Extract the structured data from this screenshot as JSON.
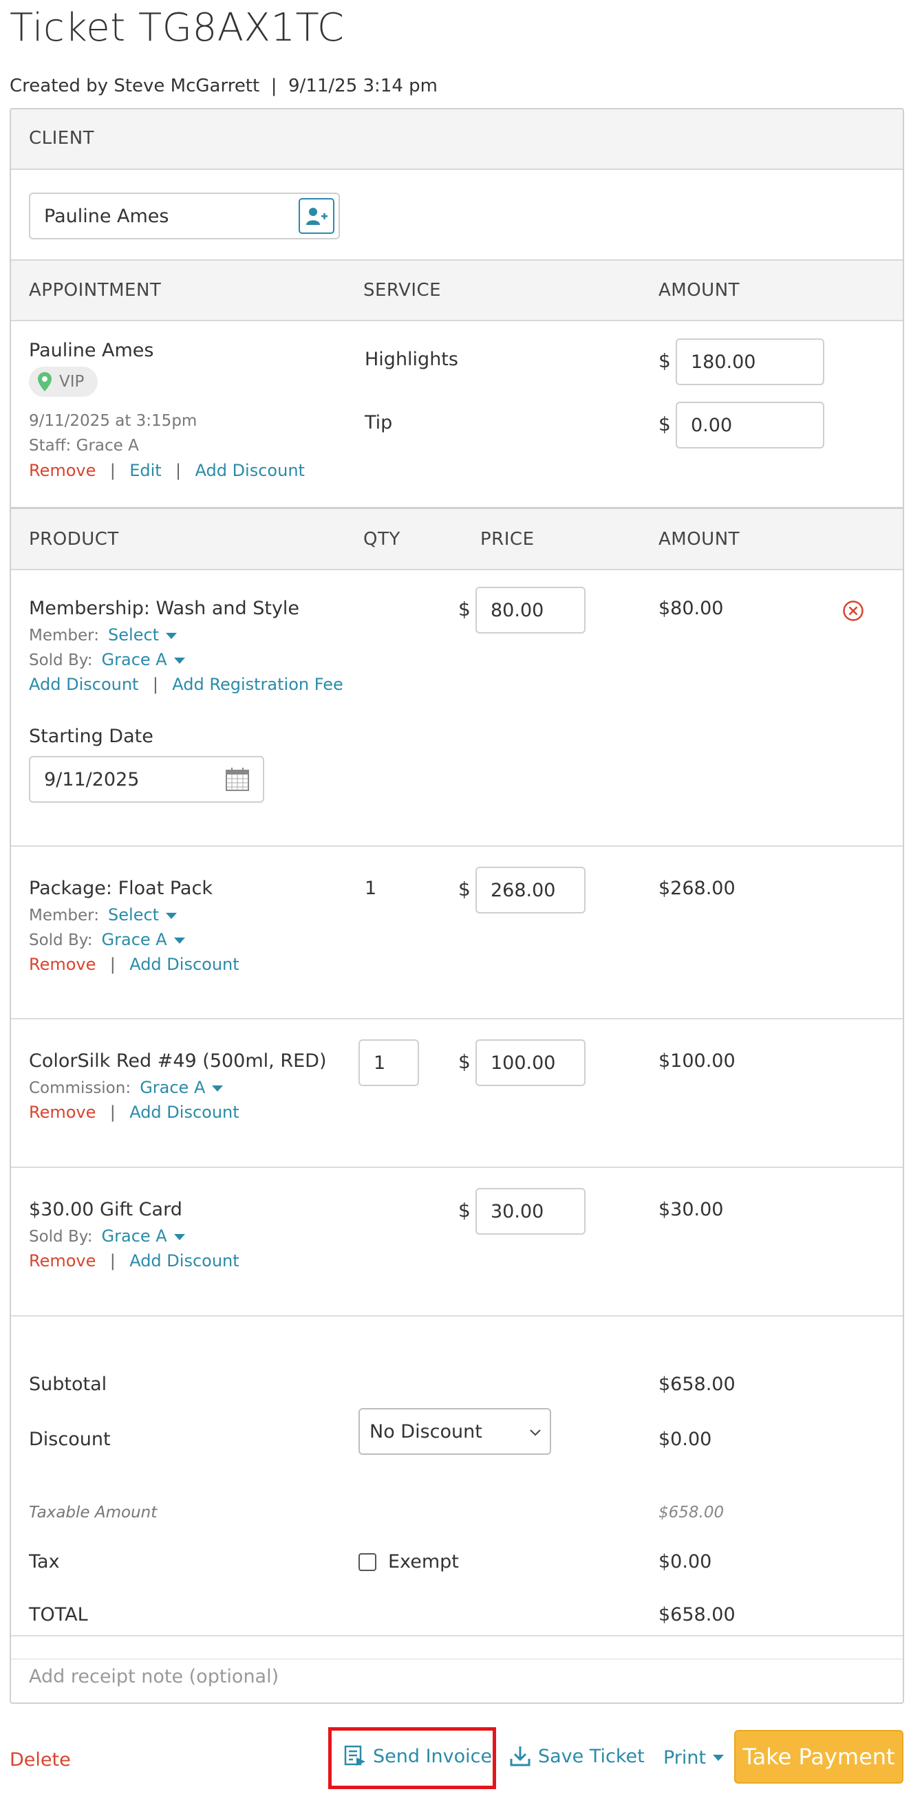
{
  "header": {
    "title": "Ticket TG8AX1TC",
    "created": "Created by Steve McGarrett  |  9/11/25 3:14 pm"
  },
  "client": {
    "section_label": "CLIENT",
    "name": "Pauline Ames"
  },
  "appointment_headers": {
    "appointment": "APPOINTMENT",
    "service": "SERVICE",
    "amount": "AMOUNT"
  },
  "appointment": {
    "client_name": "Pauline Ames",
    "badge": "VIP",
    "datetime": "9/11/2025 at 3:15pm",
    "staff": "Staff: Grace A",
    "remove": "Remove",
    "edit": "Edit",
    "add_discount": "Add Discount",
    "services": [
      {
        "name": "Highlights",
        "currency": "$",
        "amount": "180.00"
      },
      {
        "name": "Tip",
        "currency": "$",
        "amount": "0.00"
      }
    ]
  },
  "product_headers": {
    "product": "PRODUCT",
    "qty": "QTY",
    "price": "PRICE",
    "amount": "AMOUNT"
  },
  "products": [
    {
      "name": "Membership: Wash and Style",
      "member_label": "Member:",
      "member_value": "Select",
      "sold_by_label": "Sold By:",
      "sold_by_value": "Grace A",
      "add_discount": "Add Discount",
      "add_registration_fee": "Add Registration Fee",
      "starting_date_label": "Starting Date",
      "starting_date": "9/11/2025",
      "currency": "$",
      "price": "80.00",
      "amount": "$80.00"
    },
    {
      "name": "Package: Float Pack",
      "qty": "1",
      "member_label": "Member:",
      "member_value": "Select",
      "sold_by_label": "Sold By:",
      "sold_by_value": "Grace A",
      "remove": "Remove",
      "add_discount": "Add Discount",
      "currency": "$",
      "price": "268.00",
      "amount": "$268.00"
    },
    {
      "name": "ColorSilk Red #49 (500ml, RED)",
      "qty": "1",
      "commission_label": "Commission:",
      "commission_value": "Grace A",
      "remove": "Remove",
      "add_discount": "Add Discount",
      "currency": "$",
      "price": "100.00",
      "amount": "$100.00"
    },
    {
      "name": "$30.00 Gift Card",
      "sold_by_label": "Sold By:",
      "sold_by_value": "Grace A",
      "remove": "Remove",
      "add_discount": "Add Discount",
      "currency": "$",
      "price": "30.00",
      "amount": "$30.00"
    }
  ],
  "totals": {
    "subtotal_label": "Subtotal",
    "subtotal": "$658.00",
    "discount_label": "Discount",
    "discount_option": "No Discount",
    "discount": "$0.00",
    "taxable_label": "Taxable Amount",
    "taxable": "$658.00",
    "tax_label": "Tax",
    "exempt_label": "Exempt",
    "tax": "$0.00",
    "total_label": "TOTAL",
    "total": "$658.00"
  },
  "receipt_note": {
    "placeholder": "Add receipt note (optional)"
  },
  "footer": {
    "delete": "Delete",
    "send_invoice": "Send Invoice",
    "save_ticket": "Save Ticket",
    "print": "Print",
    "take_payment": "Take Payment"
  },
  "colors": {
    "link": "#2a8ba8",
    "danger": "#d9442c",
    "primary_button": "#f6b93b",
    "highlight_box": "#e6141b"
  }
}
